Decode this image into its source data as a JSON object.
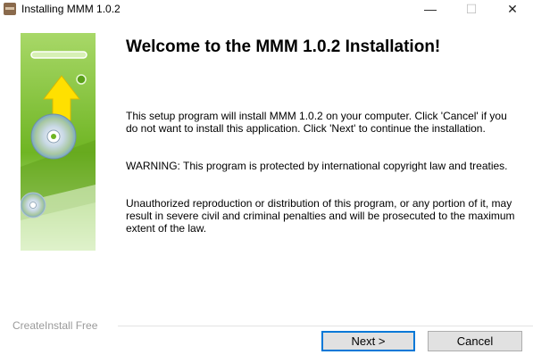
{
  "window": {
    "title": "Installing MMM 1.0.2",
    "minimize_glyph": "—",
    "maximize_glyph": "☐",
    "close_glyph": "✕"
  },
  "main": {
    "heading": "Welcome to the MMM 1.0.2 Installation!",
    "paragraphs": [
      "This setup program will install MMM 1.0.2 on your computer. Click 'Cancel' if you do not want to install this application. Click 'Next' to continue the installation.",
      "WARNING: This program is protected by international copyright law and treaties.",
      "Unauthorized reproduction or distribution of this program, or any portion of it, may result in severe civil and criminal penalties and will be prosecuted to the maximum extent of the law."
    ]
  },
  "footer": {
    "brand": "CreateInstall Free",
    "next_label": "Next >",
    "cancel_label": "Cancel"
  },
  "colors": {
    "banner_green": "#6fb523",
    "accent_blue": "#0078d7",
    "arrow_yellow": "#ffe000"
  },
  "icons": [
    "app-icon",
    "minimize-icon",
    "maximize-icon",
    "close-icon",
    "upload-arrow-icon",
    "cd-disc-icon"
  ]
}
